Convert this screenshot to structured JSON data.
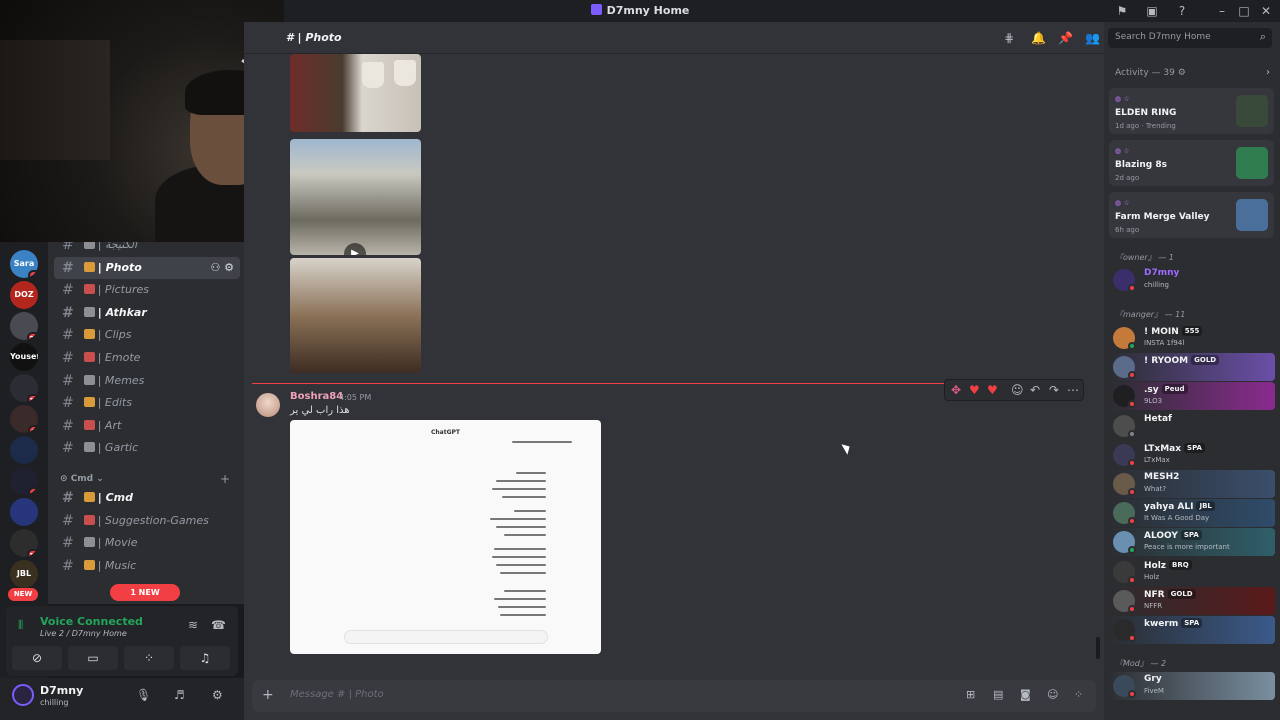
{
  "window": {
    "title": "D7mny Home"
  },
  "server_rail": {
    "servers": [
      {
        "name": "Sara Lu",
        "badge": "5",
        "color": "#3b82c4"
      },
      {
        "name": "DOZ",
        "badge": "",
        "color": "#b3261e"
      },
      {
        "name": "",
        "badge": "23",
        "color": "#4a4a52"
      },
      {
        "name": "Yousef",
        "badge": "",
        "color": "#111111"
      },
      {
        "name": "",
        "badge": "15",
        "color": "#2c2c34"
      },
      {
        "name": "",
        "badge": "7",
        "color": "#3a2a2a"
      },
      {
        "name": "",
        "badge": "",
        "color": "#1c2b4a"
      },
      {
        "name": "",
        "badge": "8",
        "color": "#1f2030"
      },
      {
        "name": "",
        "badge": "",
        "color": "#27367a"
      },
      {
        "name": "",
        "badge": "17",
        "color": "#2d2d2d"
      },
      {
        "name": "JBL",
        "badge": "",
        "color": "#3a3020"
      }
    ],
    "new_label": "NEW"
  },
  "sidebar": {
    "channels": [
      {
        "name": "ألكنيجة",
        "active": false,
        "bold": false
      },
      {
        "name": "Photo",
        "active": true,
        "bold": false
      },
      {
        "name": "Pictures",
        "active": false,
        "bold": false
      },
      {
        "name": "Athkar",
        "active": false,
        "bold": true
      },
      {
        "name": "Clips",
        "active": false,
        "bold": false
      },
      {
        "name": "Emote",
        "active": false,
        "bold": false
      },
      {
        "name": "Memes",
        "active": false,
        "bold": false
      },
      {
        "name": "Edits",
        "active": false,
        "bold": false
      },
      {
        "name": "Art",
        "active": false,
        "bold": false
      },
      {
        "name": "Gartic",
        "active": false,
        "bold": false
      }
    ],
    "category": "Cmd",
    "cmd_channels": [
      {
        "name": "Cmd",
        "bold": true
      },
      {
        "name": "Suggestion-Games",
        "bold": false
      },
      {
        "name": "Movie",
        "bold": false
      },
      {
        "name": "Music",
        "bold": false
      }
    ],
    "mention_pill": "1 NEW MENTION"
  },
  "voice": {
    "status": "Voice Connected",
    "channel": "Live 2 / D7mny Home"
  },
  "user": {
    "name": "D7mny",
    "status": "chilling"
  },
  "chat": {
    "channel_title": "Photo",
    "message": {
      "author": "Boshra84",
      "time": "4:05 PM",
      "text": "هذا راب لي ير"
    },
    "screenshot": {
      "title": "ChatGPT",
      "input_placeholder": "اسأل عن أي شيء"
    },
    "composer_placeholder": "Message # | Photo"
  },
  "activity": {
    "header": "Activity — 39",
    "cards": [
      {
        "game": "ELDEN RING",
        "meta": "1d ago  ·  Trending",
        "art_color": "#3a4a3a"
      },
      {
        "game": "Blazing 8s",
        "meta": "2d ago",
        "art_color": "#2f7d4f"
      },
      {
        "game": "Farm Merge Valley",
        "meta": "6h ago",
        "art_color": "#4a6f9a"
      }
    ]
  },
  "search": {
    "placeholder": "Search D7mny Home"
  },
  "members": {
    "roles": [
      {
        "label": "『owner』 — 1"
      },
      {
        "label": "『manger』 — 11"
      },
      {
        "label": "『Mod』 — 2"
      }
    ],
    "owner": [
      {
        "name": "D7mny",
        "status": "chilling",
        "tag": "",
        "name_color": "#9d6bff",
        "bg": "",
        "av": "#3b2f6b",
        "dot": "#f23f43"
      }
    ],
    "managers": [
      {
        "name": "! MOIN",
        "status": "INSTA 1f94l",
        "tag": "555",
        "name_color": "#f2f3f5",
        "bg": "",
        "av": "#c47a3a",
        "dot": "#23a55a"
      },
      {
        "name": "! RYOOM",
        "status": "",
        "tag": "GOLD",
        "name_color": "#f2f3f5",
        "bg": "linear-gradient(90deg,#2b2d31,#6b4fa8)",
        "av": "#5a6c8a",
        "dot": "#f23f43"
      },
      {
        "name": ".sy",
        "status": "9LO3",
        "tag": "Peud",
        "name_color": "#f2f3f5",
        "bg": "linear-gradient(90deg,#2b2d31,#8a2b8f)",
        "av": "#1f1f22",
        "dot": "#f23f43"
      },
      {
        "name": "Hetaf",
        "status": "",
        "tag": "",
        "name_color": "#f2f3f5",
        "bg": "",
        "av": "#4d4d4d",
        "dot": "#80848e"
      },
      {
        "name": "LTxMax",
        "status": "LTxMax",
        "tag": "SPA",
        "name_color": "#f2f3f5",
        "bg": "",
        "av": "#3a3a55",
        "dot": "#f23f43"
      },
      {
        "name": "MESH2",
        "status": "What?",
        "tag": "",
        "name_color": "#f2f3f5",
        "bg": "linear-gradient(90deg,#2b2d31,#3a4f6d)",
        "av": "#6a5a4a",
        "dot": "#f23f43"
      },
      {
        "name": "yahya ALI",
        "status": "It Was A Good Day",
        "tag": "JBL",
        "name_color": "#f2f3f5",
        "bg": "linear-gradient(90deg,#2b2d31,#2f4c6a)",
        "av": "#4a6a5a",
        "dot": "#f23f43"
      },
      {
        "name": "ALOOY",
        "status": "Peace is more important",
        "tag": "SPA",
        "name_color": "#f2f3f5",
        "bg": "linear-gradient(90deg,#2b2d31,#2f5f6a)",
        "av": "#6a8fb0",
        "dot": "#23a55a"
      },
      {
        "name": "Holz",
        "status": "Holz",
        "tag": "BRQ",
        "name_color": "#f2f3f5",
        "bg": "",
        "av": "#3a3a3a",
        "dot": "#f23f43"
      },
      {
        "name": "NFR",
        "status": "NFFR",
        "tag": "GOLD",
        "name_color": "#f2f3f5",
        "bg": "linear-gradient(90deg,#2b2d31,#5a1a1a)",
        "av": "#5a5a5a",
        "dot": "#f23f43"
      },
      {
        "name": "kwerm",
        "status": "",
        "tag": "SPA",
        "name_color": "#f2f3f5",
        "bg": "linear-gradient(90deg,#2b2d31,#3a5a8a)",
        "av": "#2a2a2a",
        "dot": "#f23f43"
      }
    ],
    "mods": [
      {
        "name": "Gry",
        "status": "FiveM",
        "tag": "",
        "name_color": "#f2f3f5",
        "bg": "linear-gradient(90deg,#2b2d31,#7a8fa0)",
        "av": "#3a4a5a",
        "dot": "#f23f43"
      }
    ]
  }
}
